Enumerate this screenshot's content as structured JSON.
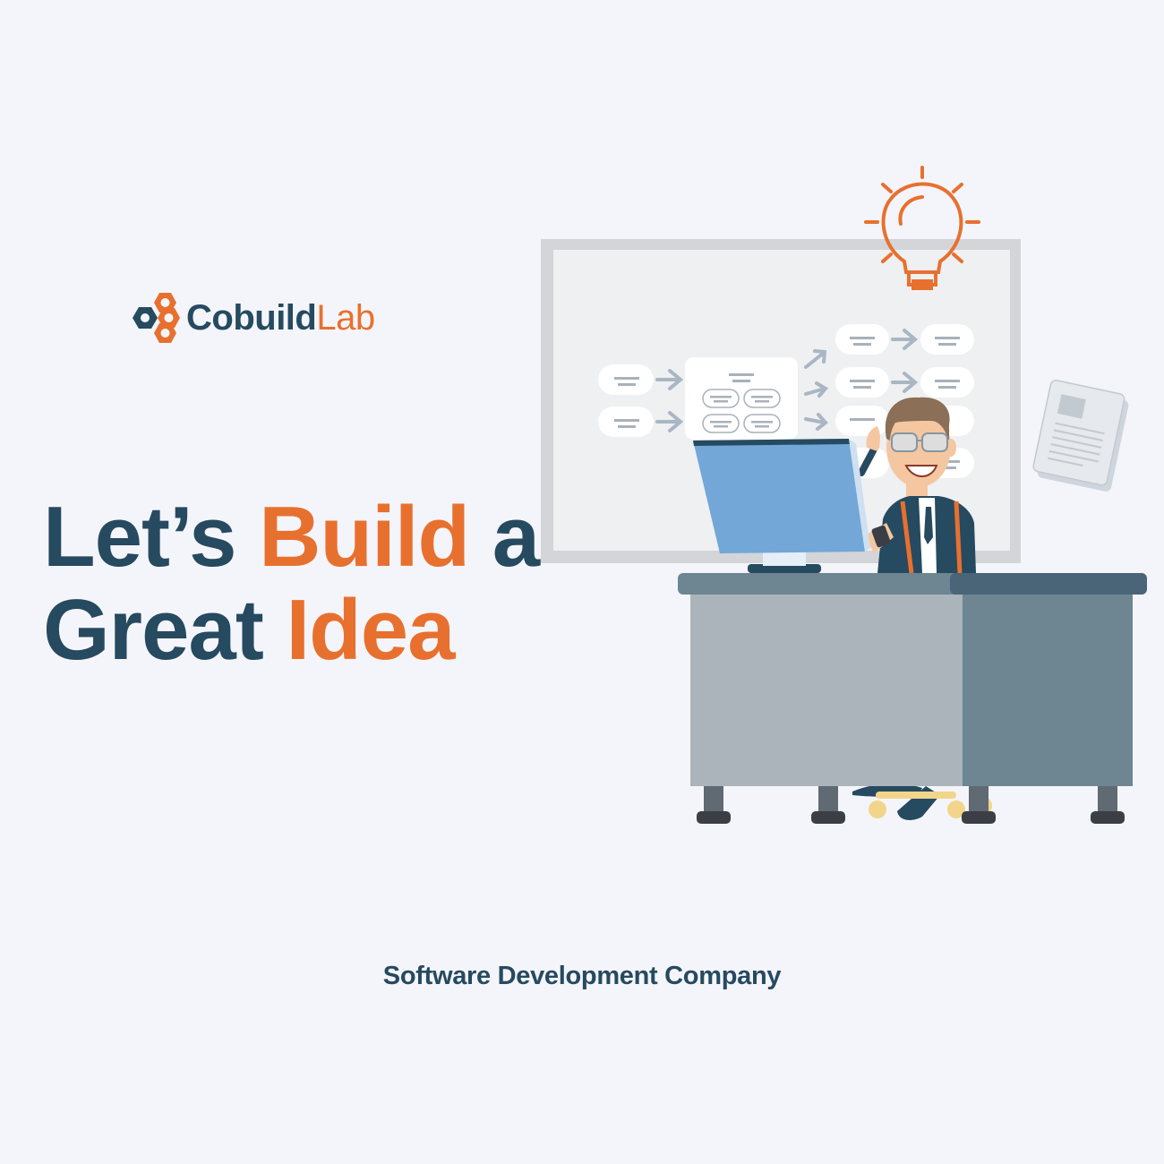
{
  "brand": {
    "name_primary": "Cobuild",
    "name_secondary": "Lab",
    "logo_icon": "hexagon-nuts-logo"
  },
  "headline": {
    "line1_part1": "Let’s ",
    "line1_accent": "Build",
    "line1_part2": " a",
    "line2_part1": "Great ",
    "line2_accent": "Idea"
  },
  "tagline": "Software Development Company",
  "illustration": {
    "subject": "developer-at-desk-with-whiteboard",
    "icons": [
      "lightbulb-icon",
      "whiteboard-flowchart",
      "document-icon",
      "computer-monitor-icon",
      "desk",
      "office-chair"
    ]
  },
  "colors": {
    "background": "#f4f5fa",
    "navy": "#264a60",
    "orange": "#e8702f",
    "desk_light": "#abb4bb",
    "desk_dark": "#6e8592",
    "monitor_blue": "#72a7d8"
  }
}
